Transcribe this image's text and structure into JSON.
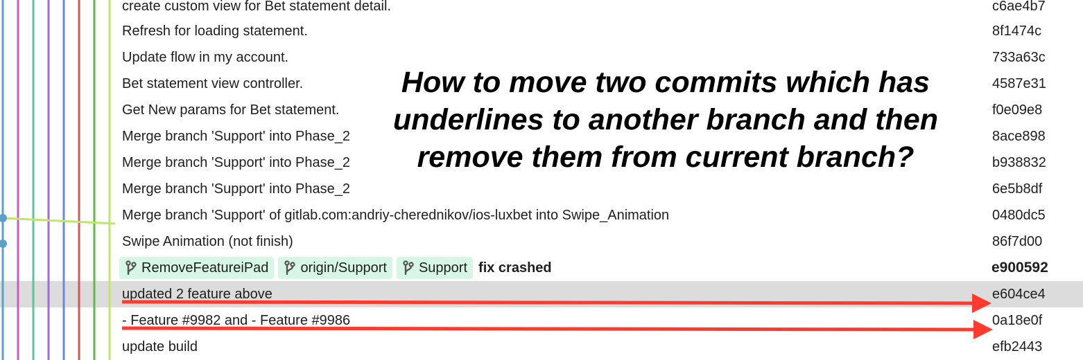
{
  "commits": [
    {
      "message": "create custom view for Bet statement detail.",
      "hash": "c6ae4b7"
    },
    {
      "message": "Refresh for loading statement.",
      "hash": "8f1474c"
    },
    {
      "message": "Update flow in my account.",
      "hash": "733a63c"
    },
    {
      "message": "Bet statement view controller.",
      "hash": "4587e31"
    },
    {
      "message": "Get New params for Bet statement.",
      "hash": "f0e09e8"
    },
    {
      "message": "Merge branch 'Support' into Phase_2",
      "hash": "8ace898"
    },
    {
      "message": "Merge branch 'Support' into Phase_2",
      "hash": "b938832"
    },
    {
      "message": "Merge branch 'Support' into Phase_2",
      "hash": "6e5b8df"
    },
    {
      "message": "Merge branch 'Support' of gitlab.com:andriy-cherednikov/ios-luxbet into Swipe_Animation",
      "hash": "0480dc5"
    },
    {
      "message": "Swipe Animation (not finish)",
      "hash": "86f7d00"
    },
    {
      "message": "fix crashed",
      "hash": "e900592",
      "refs": [
        "RemoveFeatureiPad",
        "origin/Support",
        "Support"
      ]
    },
    {
      "message": "updated 2 feature above",
      "hash": "e604ce4"
    },
    {
      "message": "- Feature #9982 and - Feature #9986",
      "hash": "0a18e0f"
    },
    {
      "message": "update build",
      "hash": "efb2443"
    }
  ],
  "annotation": {
    "lines": [
      "How to move two commits which has",
      "underlines to another branch and then",
      "remove them from current branch?"
    ],
    "arrow_color": "#ff3b30"
  },
  "graph_colors": [
    "#5aa0c8",
    "#c45ec4",
    "#5cc49a",
    "#a26ad8",
    "#6f86e0",
    "#d05858",
    "#62b84a",
    "#bbe86a"
  ],
  "selected_commit": "e604ce4",
  "ref_badge_color": "#d7f7e6"
}
